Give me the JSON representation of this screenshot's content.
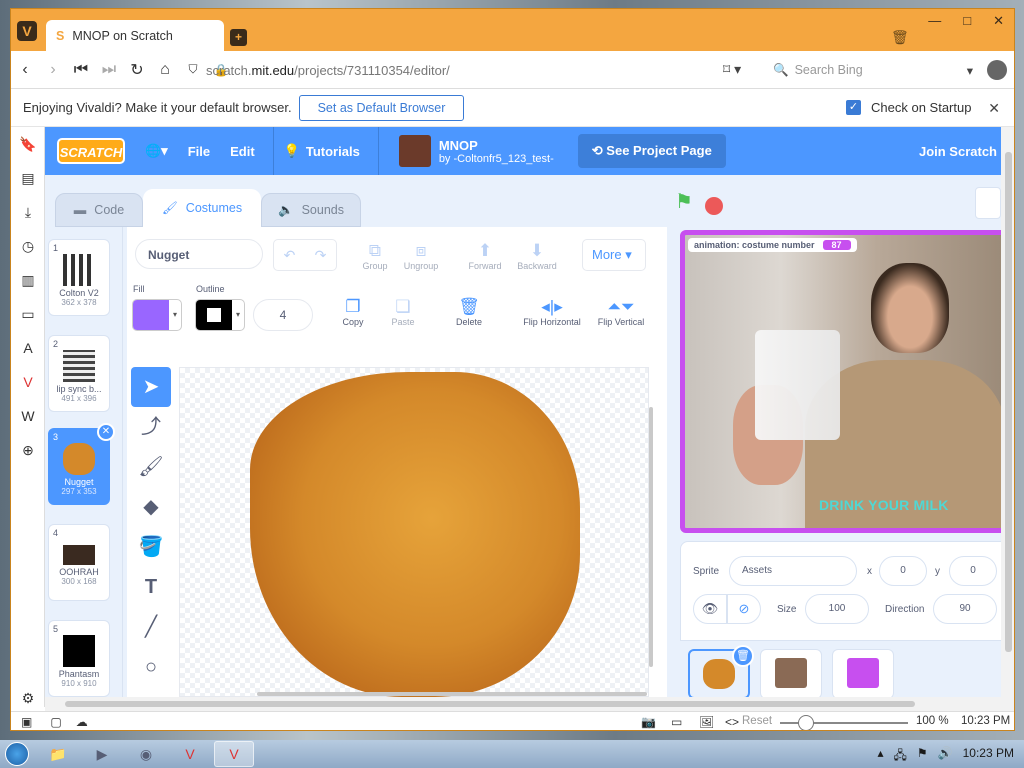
{
  "browser": {
    "tab_title": "MNOP on Scratch",
    "url_prefix": "scratch.",
    "url_domain": "mit.edu",
    "url_path": "/projects/731110354/editor/",
    "search_placeholder": "Search Bing",
    "notify_message": "Enjoying Vivaldi? Make it your default browser.",
    "notify_button": "Set as Default Browser",
    "notify_check": "Check on Startup"
  },
  "menu": {
    "logo": "SCRATCH",
    "file": "File",
    "edit": "Edit",
    "tutorials": "Tutorials",
    "project_title": "MNOP",
    "project_author": "by -Coltonfr5_123_test-",
    "see_project": "See Project Page",
    "join": "Join Scratch"
  },
  "tabs": {
    "code": "Code",
    "costumes": "Costumes",
    "sounds": "Sounds"
  },
  "costumes": [
    {
      "num": "1",
      "name": "Colton V2",
      "size": "362 x 378"
    },
    {
      "num": "2",
      "name": "lip sync b...",
      "size": "491 x 396"
    },
    {
      "num": "3",
      "name": "Nugget",
      "size": "297 x 353"
    },
    {
      "num": "4",
      "name": "OOHRAH",
      "size": "300 x 168"
    },
    {
      "num": "5",
      "name": "Phantasm",
      "size": "910 x 910"
    }
  ],
  "paint": {
    "costume_name": "Nugget",
    "group": "Group",
    "ungroup": "Ungroup",
    "forward": "Forward",
    "backward": "Backward",
    "more": "More",
    "fill_label": "Fill",
    "outline_label": "Outline",
    "fill_color": "#9966ff",
    "outline_color": "#000000",
    "outline_width": "4",
    "copy": "Copy",
    "paste": "Paste",
    "delete": "Delete",
    "flip_h": "Flip Horizontal",
    "flip_v": "Flip Vertical"
  },
  "stage": {
    "monitor_label": "animation: costume number",
    "monitor_value": "87",
    "caption": "DRINK YOUR MILK"
  },
  "sprite_info": {
    "sprite_label": "Sprite",
    "sprite_name": "Assets",
    "x_label": "x",
    "x": "0",
    "y_label": "y",
    "y": "0",
    "show_label": "Show",
    "size_label": "Size",
    "size": "100",
    "direction_label": "Direction",
    "direction": "90"
  },
  "status": {
    "reset": "Reset",
    "zoom": "100 %",
    "time": "10:23 PM"
  },
  "taskbar": {
    "time": "10:23 PM"
  },
  "colors": {
    "scratch_blue": "#4c97ff",
    "vivaldi_orange": "#f4a640",
    "stage_border": "#c74fef"
  }
}
